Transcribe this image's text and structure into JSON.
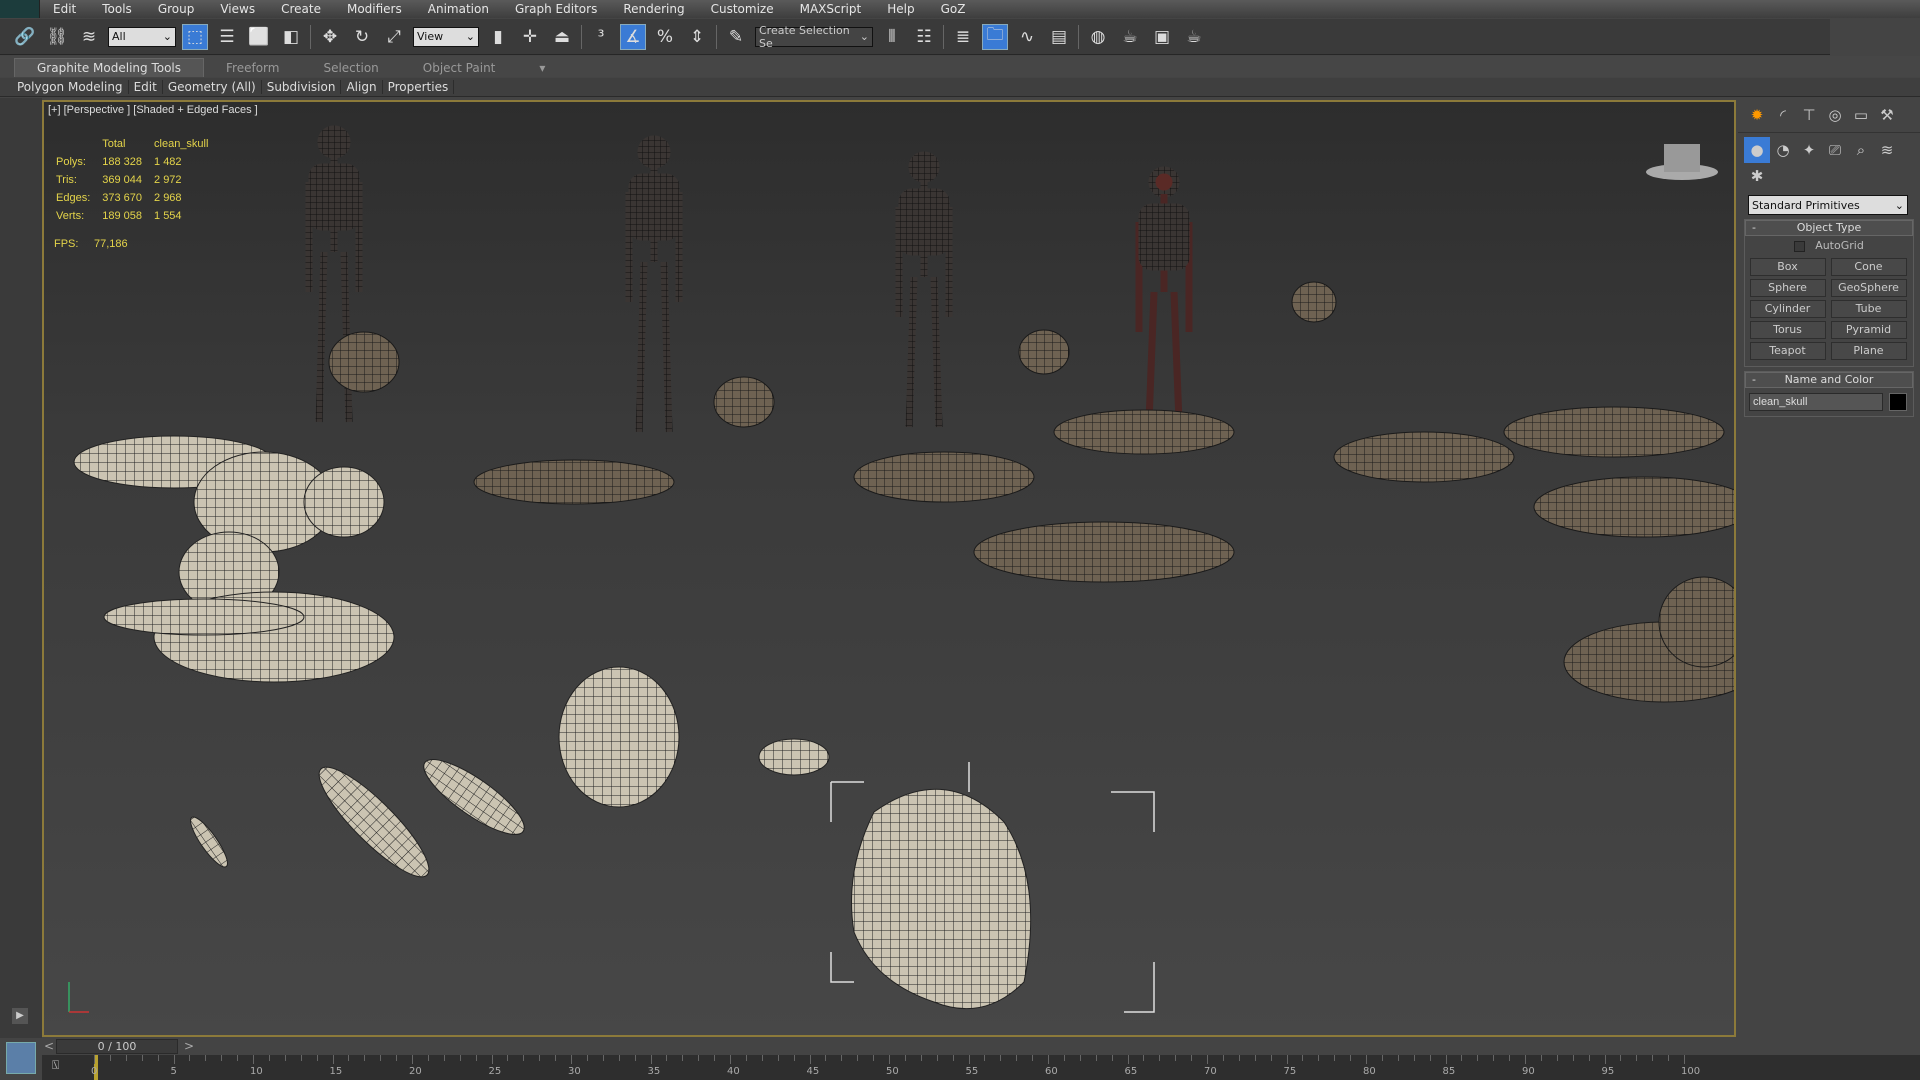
{
  "menu": [
    "Edit",
    "Tools",
    "Group",
    "Views",
    "Create",
    "Modifiers",
    "Animation",
    "Graph Editors",
    "Rendering",
    "Customize",
    "MAXScript",
    "Help",
    "GoZ"
  ],
  "toolbar": {
    "filter": "All",
    "ref_coord": "View",
    "selection_set": "Create Selection Se"
  },
  "ribbon": {
    "tabs": [
      "Graphite Modeling Tools",
      "Freeform",
      "Selection",
      "Object Paint"
    ],
    "sub": [
      "Polygon Modeling",
      "Edit",
      "Geometry (All)",
      "Subdivision",
      "Align",
      "Properties"
    ]
  },
  "viewport": {
    "label": "[+] [Perspective ] [Shaded + Edged Faces ]",
    "stats": {
      "col_total": "Total",
      "col_obj": "clean_skull",
      "rows": [
        {
          "k": "Polys:",
          "t": "188 328",
          "o": "1 482"
        },
        {
          "k": "Tris:",
          "t": "369 044",
          "o": "2 972"
        },
        {
          "k": "Edges:",
          "t": "373 670",
          "o": "2 968"
        },
        {
          "k": "Verts:",
          "t": "189 058",
          "o": "1 554"
        }
      ],
      "fps_label": "FPS:",
      "fps": "77,186"
    }
  },
  "command_panel": {
    "category": "Standard Primitives",
    "object_type": "Object Type",
    "autogrid": "AutoGrid",
    "buttons": [
      "Box",
      "Cone",
      "Sphere",
      "GeoSphere",
      "Cylinder",
      "Tube",
      "Torus",
      "Pyramid",
      "Teapot",
      "Plane"
    ],
    "name_color": "Name and Color",
    "object_name": "clean_skull",
    "object_color": "#000000"
  },
  "timeline": {
    "frame": "0 / 100",
    "ticks": [
      "0",
      "5",
      "10",
      "15",
      "20",
      "25",
      "30",
      "35",
      "40",
      "45",
      "50",
      "55",
      "60",
      "65",
      "70",
      "75",
      "80",
      "85",
      "90",
      "95",
      "100"
    ]
  }
}
